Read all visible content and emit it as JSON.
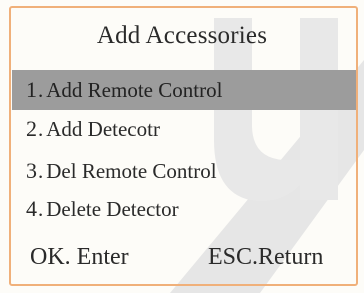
{
  "title": "Add Accessories",
  "menu": [
    {
      "number": "1",
      "label": "Add Remote Control",
      "selected": true
    },
    {
      "number": "2",
      "label": "Add Detecotr",
      "selected": false
    },
    {
      "number": "3",
      "label": "Del Remote Control",
      "selected": false
    },
    {
      "number": "4",
      "label": "Delete Detector",
      "selected": false
    }
  ],
  "footer": {
    "ok_label": "OK. Enter",
    "esc_label": "ESC.Return"
  },
  "colors": {
    "selected_bg": "#9c9c9c",
    "frame": "#f0b07a",
    "watermark": "#e3e3e3"
  }
}
